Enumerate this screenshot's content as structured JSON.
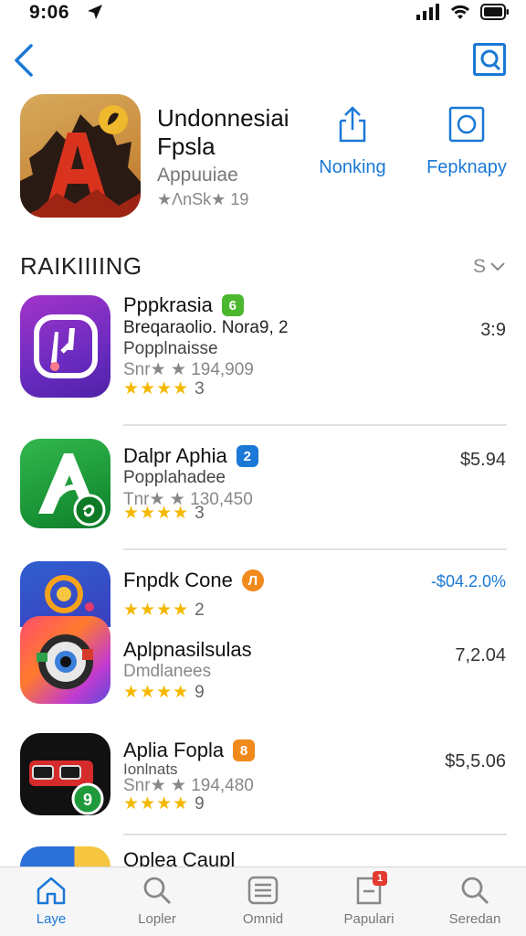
{
  "status_bar": {
    "time": "9:06"
  },
  "hero": {
    "title": "Undonnesiai Fpsla",
    "subtitle": "Appuuiae",
    "rating_text": "★ɅnSk★ 19",
    "actions": [
      {
        "label": "Nonking",
        "icon": "share-icon"
      },
      {
        "label": "Fepknapy",
        "icon": "circle-square-icon"
      }
    ]
  },
  "section": {
    "title": "RAIKIIIING",
    "sort_label": "S"
  },
  "apps": [
    {
      "name": "Pppkrasia",
      "badge": "6",
      "badge_color": "#4cb82f",
      "line1": "Breqaraolio. Nora9, 2",
      "line2": "Popplnaisse",
      "line3": "Snr★ ★ 194,909",
      "stars": "★★★★",
      "star_count": "3",
      "price": "3:9"
    },
    {
      "name": "Dalpr Aphia",
      "badge": "2",
      "badge_color": "#1a78d6",
      "line1": "Popplahadee",
      "line3": "Tnr★ ★ 130,450",
      "stars": "★★★★",
      "star_count": "3",
      "price": "$5.94"
    },
    {
      "name": "Fnpdk Cone",
      "badge": "Л",
      "badge_color": "#f08a1c",
      "stars": "★★★★",
      "star_count": "2",
      "price": "-$04.2.0%",
      "price_color": "#1a78d6"
    },
    {
      "name": "Aplpnasilsulas",
      "line1": "Dmdlanees",
      "stars": "★★★★",
      "star_count": "9",
      "price": "7,2.04"
    },
    {
      "name": "Aplia Fopla",
      "badge": "8",
      "badge_color": "#f08a1c",
      "line1": "Ionlnats",
      "line3": "Snr★ ★ 194,480",
      "stars": "★★★★",
      "star_count": "9",
      "price": "$5,5.06"
    },
    {
      "name": "Oplea Caupl"
    }
  ],
  "tabs": [
    {
      "label": "Laye",
      "icon": "home-icon",
      "active": true
    },
    {
      "label": "Lopler",
      "icon": "search-icon"
    },
    {
      "label": "Omnid",
      "icon": "list-icon"
    },
    {
      "label": "Papulari",
      "icon": "document-icon",
      "notification": "1"
    },
    {
      "label": "Seredan",
      "icon": "search-icon"
    }
  ],
  "colors": {
    "accent": "#1a78d6",
    "star": "#f5b800"
  }
}
